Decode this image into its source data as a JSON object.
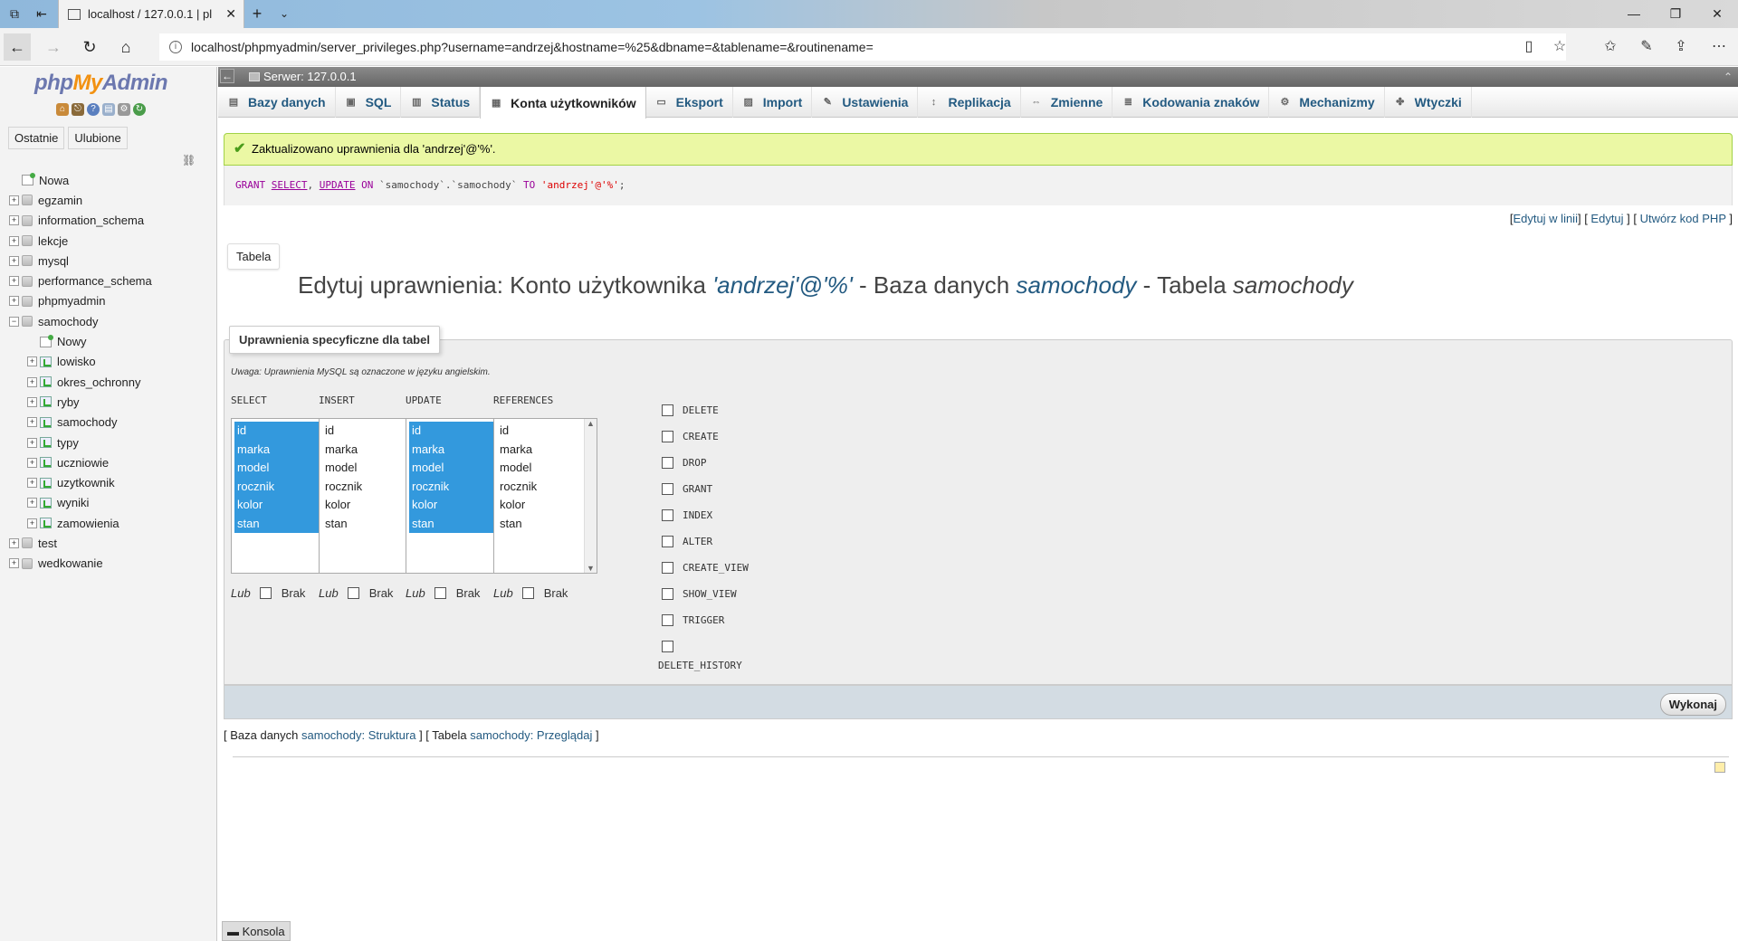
{
  "browser": {
    "tab_title": "localhost / 127.0.0.1 | pl",
    "url": "localhost/phpmyadmin/server_privileges.php?username=andrzej&hostname=%25&dbname=&tablename=&routinename="
  },
  "nav": {
    "logo_php": "php",
    "logo_my": "My",
    "logo_admin": "Admin",
    "tabs": [
      "Ostatnie",
      "Ulubione"
    ],
    "tree": [
      {
        "label": "Nowa",
        "type": "new",
        "level": 0
      },
      {
        "label": "egzamin",
        "type": "db",
        "level": 0
      },
      {
        "label": "information_schema",
        "type": "db",
        "level": 0
      },
      {
        "label": "lekcje",
        "type": "db",
        "level": 0
      },
      {
        "label": "mysql",
        "type": "db",
        "level": 0
      },
      {
        "label": "performance_schema",
        "type": "db",
        "level": 0
      },
      {
        "label": "phpmyadmin",
        "type": "db",
        "level": 0
      },
      {
        "label": "samochody",
        "type": "db-open",
        "level": 0
      },
      {
        "label": "Nowy",
        "type": "new",
        "level": 1
      },
      {
        "label": "lowisko",
        "type": "table",
        "level": 1
      },
      {
        "label": "okres_ochronny",
        "type": "table",
        "level": 1
      },
      {
        "label": "ryby",
        "type": "table",
        "level": 1
      },
      {
        "label": "samochody",
        "type": "table",
        "level": 1
      },
      {
        "label": "typy",
        "type": "table",
        "level": 1
      },
      {
        "label": "uczniowie",
        "type": "table",
        "level": 1
      },
      {
        "label": "uzytkownik",
        "type": "table",
        "level": 1
      },
      {
        "label": "wyniki",
        "type": "table",
        "level": 1
      },
      {
        "label": "zamowienia",
        "type": "table",
        "level": 1
      },
      {
        "label": "test",
        "type": "db",
        "level": 0
      },
      {
        "label": "wedkowanie",
        "type": "db",
        "level": 0
      }
    ]
  },
  "server": {
    "label": "Serwer: 127.0.0.1"
  },
  "menu": [
    {
      "label": "Bazy danych",
      "icon": "database-icon",
      "active": false
    },
    {
      "label": "SQL",
      "icon": "sql-icon",
      "active": false
    },
    {
      "label": "Status",
      "icon": "status-icon",
      "active": false
    },
    {
      "label": "Konta użytkowników",
      "icon": "users-icon",
      "active": true
    },
    {
      "label": "Eksport",
      "icon": "export-icon",
      "active": false
    },
    {
      "label": "Import",
      "icon": "import-icon",
      "active": false
    },
    {
      "label": "Ustawienia",
      "icon": "wrench-icon",
      "active": false
    },
    {
      "label": "Replikacja",
      "icon": "replication-icon",
      "active": false
    },
    {
      "label": "Zmienne",
      "icon": "variables-icon",
      "active": false
    },
    {
      "label": "Kodowania znaków",
      "icon": "charset-icon",
      "active": false
    },
    {
      "label": "Mechanizmy",
      "icon": "engines-icon",
      "active": false
    },
    {
      "label": "Wtyczki",
      "icon": "plugins-icon",
      "active": false
    }
  ],
  "message": {
    "text": "Zaktualizowano uprawnienia dla 'andrzej'@'%'."
  },
  "sql": {
    "grant": "GRANT",
    "select": "SELECT",
    "comma": ",",
    "update": "UPDATE",
    "on": "ON",
    "target": "`samochody`.`samochody`",
    "to": "TO",
    "user": "'andrzej'@'%'",
    "end": ";"
  },
  "sql_links": {
    "inline": "Edytuj w linii",
    "edit": "Edytuj",
    "php": "Utwórz kod PHP"
  },
  "tab_button": "Tabela",
  "heading": {
    "prefix": "Edytuj uprawnienia: Konto użytkownika ",
    "user": "'andrzej'@'%'",
    "mid1": " - Baza danych ",
    "db": "samochody",
    "mid2": " - Tabela ",
    "table": "samochody"
  },
  "privileges": {
    "legend": "Uprawnienia specyficzne dla tabel",
    "note": "Uwaga: Uprawnienia MySQL są oznaczone w języku angielskim.",
    "columns_list": [
      "id",
      "marka",
      "model",
      "rocznik",
      "kolor",
      "stan"
    ],
    "column_groups": [
      {
        "name": "SELECT",
        "selected": true
      },
      {
        "name": "INSERT",
        "selected": false
      },
      {
        "name": "UPDATE",
        "selected": true
      },
      {
        "name": "REFERENCES",
        "selected": false
      }
    ],
    "lub": "Lub",
    "brak": "Brak",
    "checkboxes": [
      "DELETE",
      "CREATE",
      "DROP",
      "GRANT",
      "INDEX",
      "ALTER",
      "CREATE_VIEW",
      "SHOW_VIEW",
      "TRIGGER"
    ],
    "last_checkbox": "DELETE_HISTORY",
    "submit": "Wykonaj"
  },
  "bottom": {
    "db_prefix": "Baza danych ",
    "db_link": "samochody: Struktura",
    "table_prefix": "Tabela ",
    "table_link": "samochody: Przeglądaj"
  },
  "console": "Konsola"
}
